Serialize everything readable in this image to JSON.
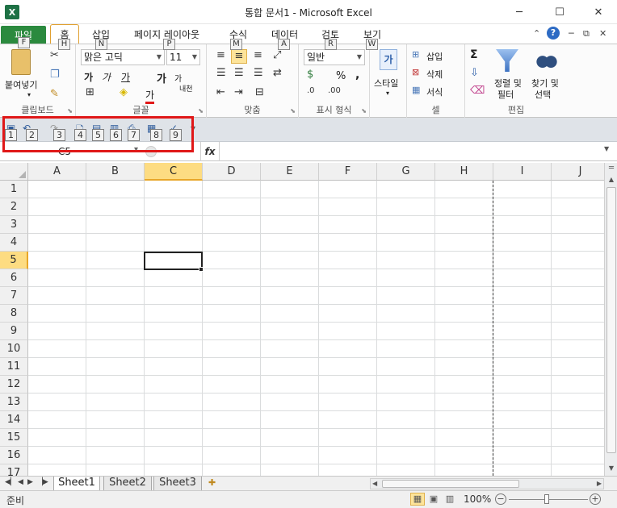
{
  "window": {
    "title": "통합 문서1 - Microsoft Excel",
    "minimize_icon": "─",
    "maximize_icon": "☐",
    "close_icon": "✕"
  },
  "tabs": {
    "file": "파일",
    "home": "홈",
    "insert": "삽입",
    "page_layout": "페이지 레이아웃",
    "formulas": "수식",
    "data": "데이터",
    "review": "검토",
    "view": "보기"
  },
  "keytips": {
    "file": "F",
    "home": "H",
    "insert": "N",
    "page_layout": "P",
    "formulas": "M",
    "data": "A",
    "review": "R",
    "view": "W"
  },
  "ribbon": {
    "clipboard": {
      "label": "클립보드",
      "paste": "붙여넣기"
    },
    "font": {
      "label": "글꼴",
      "font_name": "맑은 고딕",
      "font_size": "11",
      "bold": "가",
      "italic": "가",
      "underline": "가",
      "grow": "가",
      "shrink": "가",
      "phonetic": "내천",
      "font_color": "가"
    },
    "alignment": {
      "label": "맞춤"
    },
    "number": {
      "label": "표시 형식",
      "format": "일반",
      "percent": "%",
      "comma": ","
    },
    "styles": {
      "label": "스타일",
      "style_icon": "가"
    },
    "cells": {
      "label": "셀",
      "insert": "삽입",
      "delete": "삭제",
      "format": "서식"
    },
    "editing": {
      "label": "편집",
      "sum": "Σ",
      "sort_filter": "정렬 및 필터",
      "sort_filter_line1": "정렬 및",
      "sort_filter_line2": "필터",
      "find_select_line1": "찾기 및",
      "find_select_line2": "선택"
    }
  },
  "qat": {
    "numbers": [
      "1",
      "2",
      "3",
      "4",
      "5",
      "6",
      "7",
      "8",
      "9"
    ]
  },
  "formula_bar": {
    "name_box": "C5",
    "fx": "fx",
    "value": ""
  },
  "grid": {
    "columns": [
      "A",
      "B",
      "C",
      "D",
      "E",
      "F",
      "G",
      "H",
      "I",
      "J"
    ],
    "rows": [
      "1",
      "2",
      "3",
      "4",
      "5",
      "6",
      "7",
      "8",
      "9",
      "10",
      "11",
      "12",
      "13",
      "14",
      "15",
      "16",
      "17"
    ],
    "active_column": "C",
    "active_row": "5"
  },
  "sheets": {
    "tabs": [
      "Sheet1",
      "Sheet2",
      "Sheet3"
    ],
    "active": "Sheet1"
  },
  "status": {
    "text": "준비",
    "zoom": "100%"
  },
  "colors": {
    "file_tab": "#2b8a3e",
    "active_header": "#fddc82",
    "highlight_border": "#e01818"
  }
}
